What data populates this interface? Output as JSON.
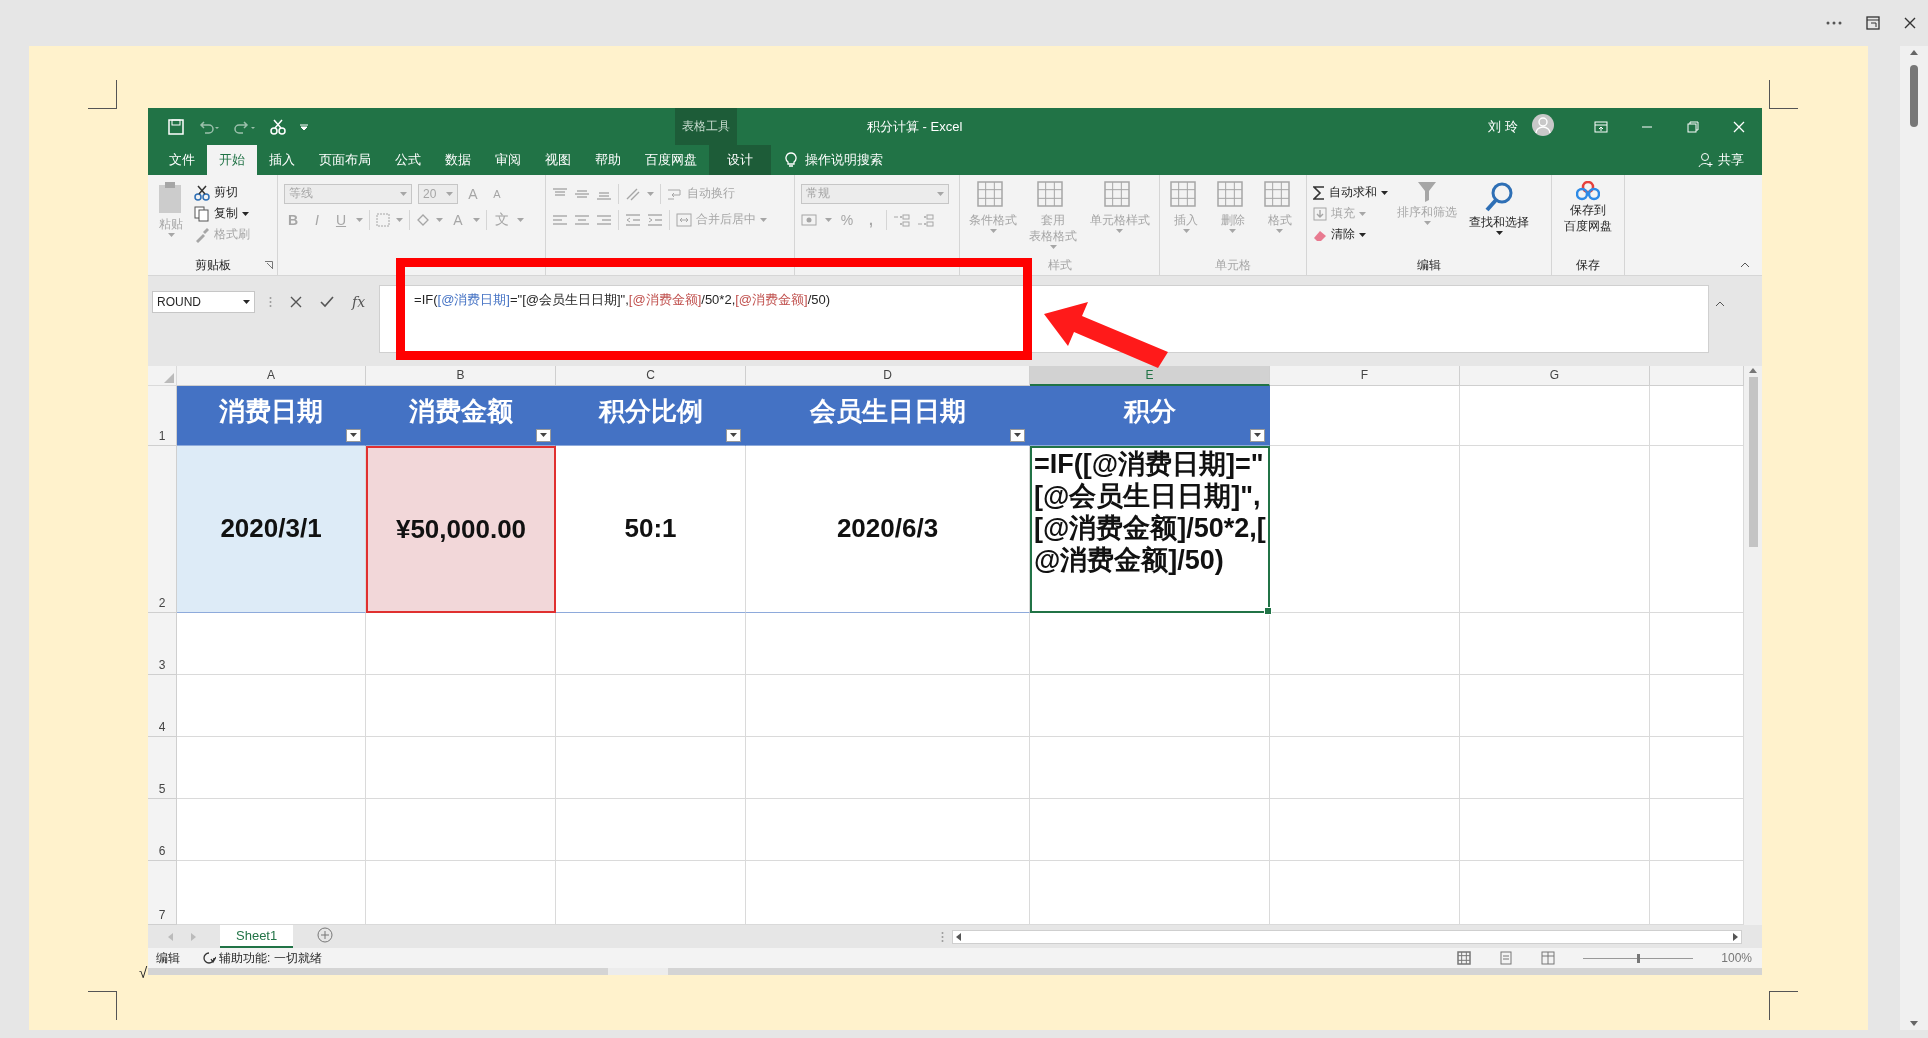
{
  "window": {
    "title": "积分计算 - Excel",
    "context_group": "表格工具",
    "user": "刘 玲",
    "search_hint": "操作说明搜索",
    "share": "共享"
  },
  "tabs": [
    {
      "label": "文件",
      "selected": false,
      "contextual": false
    },
    {
      "label": "开始",
      "selected": true,
      "contextual": false
    },
    {
      "label": "插入",
      "selected": false,
      "contextual": false
    },
    {
      "label": "页面布局",
      "selected": false,
      "contextual": false
    },
    {
      "label": "公式",
      "selected": false,
      "contextual": false
    },
    {
      "label": "数据",
      "selected": false,
      "contextual": false
    },
    {
      "label": "审阅",
      "selected": false,
      "contextual": false
    },
    {
      "label": "视图",
      "selected": false,
      "contextual": false
    },
    {
      "label": "帮助",
      "selected": false,
      "contextual": false
    },
    {
      "label": "百度网盘",
      "selected": false,
      "contextual": false
    },
    {
      "label": "设计",
      "selected": false,
      "contextual": true
    }
  ],
  "ribbon": [
    {
      "kind": "clipboard",
      "label": "剪贴板",
      "items": [
        {
          "label": "粘贴",
          "disabled": true
        },
        {
          "label": "剪切",
          "disabled": false
        },
        {
          "label": "复制",
          "disabled": false
        },
        {
          "label": "格式刷",
          "disabled": true
        }
      ]
    },
    {
      "kind": "font",
      "disabled": true,
      "fields": [
        "等线",
        "20"
      ],
      "buttons": [
        "A",
        "A",
        "B",
        "I",
        "U",
        "A",
        "文"
      ]
    },
    {
      "kind": "alignment",
      "disabled": true,
      "items": [
        "自动换行",
        "合并后居中"
      ]
    },
    {
      "kind": "number",
      "disabled": true,
      "fields": [
        "常规"
      ],
      "buttons": [
        "%",
        ","
      ]
    },
    {
      "kind": "styles",
      "label": "样式",
      "disabled": true,
      "items": [
        [
          "条件格式"
        ],
        [
          "套用",
          "表格格式"
        ],
        [
          "单元格样式"
        ]
      ]
    },
    {
      "kind": "cells",
      "label": "单元格",
      "disabled": true,
      "items": [
        [
          "插入"
        ],
        [
          "删除"
        ],
        [
          "格式"
        ]
      ]
    },
    {
      "kind": "editing",
      "label": "编辑",
      "items": [
        {
          "label": "自动求和",
          "disabled": false
        },
        {
          "label": "填充",
          "disabled": true
        },
        {
          "label": "清除",
          "disabled": false
        },
        {
          "label": "排序和筛选",
          "disabled": true
        },
        {
          "label": "查找和选择",
          "disabled": false
        }
      ]
    },
    {
      "kind": "save",
      "label": "保存",
      "items": [
        {
          "lines": [
            "保存到",
            "百度网盘"
          ],
          "disabled": false
        }
      ]
    }
  ],
  "formula_bar": {
    "name_box": "ROUND",
    "fx_label": "fx",
    "formula": [
      {
        "text": "=IF(",
        "color": "#262626"
      },
      {
        "text": "[@消费日期]",
        "color": "#4472c4"
      },
      {
        "text": "=\"[@会员生日日期]\",",
        "color": "#262626"
      },
      {
        "text": "[@消费金额]",
        "color": "#c0504d"
      },
      {
        "text": "/50*2,",
        "color": "#262626"
      },
      {
        "text": "[@消费金额]",
        "color": "#c0504d"
      },
      {
        "text": "/50)",
        "color": "#262626"
      }
    ]
  },
  "sheet": {
    "columns": [
      {
        "label": "A",
        "selected": false
      },
      {
        "label": "B",
        "selected": false
      },
      {
        "label": "C",
        "selected": false
      },
      {
        "label": "D",
        "selected": false
      },
      {
        "label": "E",
        "selected": true
      },
      {
        "label": "F",
        "selected": false
      },
      {
        "label": "G",
        "selected": false
      }
    ],
    "rows": [
      {
        "label": "1",
        "selected": false
      },
      {
        "label": "2",
        "selected": false
      },
      {
        "label": "3",
        "selected": false
      },
      {
        "label": "4",
        "selected": false
      },
      {
        "label": "5",
        "selected": false
      },
      {
        "label": "6",
        "selected": false
      },
      {
        "label": "7",
        "selected": false
      }
    ],
    "header": [
      "消费日期",
      "消费金额",
      "积分比例",
      "会员生日日期",
      "积分"
    ],
    "cells": [
      {
        "text": "2020/3/1",
        "color": "#ddebf7",
        "marked": false,
        "selected": false
      },
      {
        "text": "¥50,000.00",
        "color": "#f2d7d9",
        "marked": true,
        "selected": false
      },
      {
        "text": "50:1",
        "color": "#ffffff",
        "marked": false,
        "selected": false
      },
      {
        "text": "2020/6/3",
        "color": "#ffffff",
        "marked": false,
        "selected": false
      },
      {
        "text": "=IF([@消费日期]=\"[@会员生日日期]\",[@消费金额]/50*2,[@消费金额]/50)",
        "color": "#ffffff",
        "marked": false,
        "selected": true
      }
    ]
  },
  "sheet_tabs": [
    {
      "label": "Sheet1",
      "selected": true
    }
  ],
  "status_bar": {
    "mode": "编辑",
    "accessibility": "辅助功能: 一切就绪",
    "zoom": "100%",
    "zoom_slider": {
      "level": 0.5
    }
  },
  "page_mark": "√"
}
